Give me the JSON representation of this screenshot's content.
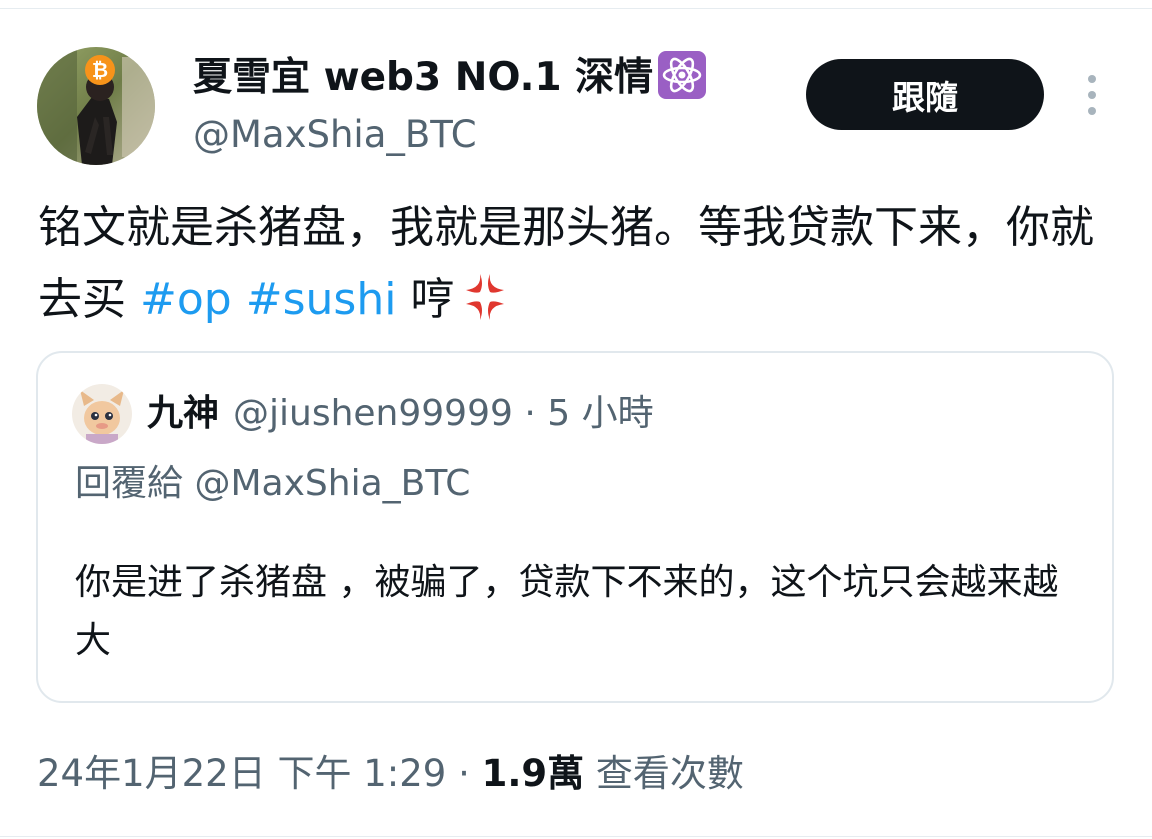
{
  "author": {
    "display_name": "夏雪宜 web3 NO.1 深情",
    "badge_icon": "atom-symbol-emoji",
    "handle": "@MaxShia_BTC",
    "avatar_icon": "bitcoin-icon"
  },
  "follow_label": "跟隨",
  "tweet": {
    "text_before": "铭文就是杀猪盘，我就是那头猪。等我贷款下来，你就去买",
    "hashtags": [
      "#op",
      "#sushi"
    ],
    "text_after": "哼",
    "emoji": "anger-symbol-emoji"
  },
  "quoted": {
    "name": "九神",
    "handle": "@jiushen99999",
    "separator": "·",
    "time": "5 小時",
    "reply_to_label": "回覆給",
    "reply_to_handle": "@MaxShia_BTC",
    "text": "你是进了杀猪盘 ，被骗了，贷款下不来的，这个坑只会越来越大"
  },
  "meta": {
    "timestamp": "24年1月22日 下午 1:29",
    "separator": "·",
    "views_count": "1.9萬",
    "views_label": "查看次數"
  },
  "colors": {
    "text": "#0f1419",
    "secondary": "#536471",
    "link": "#1d9bf0",
    "button_bg": "#0f1419",
    "border": "#e1e8ed"
  }
}
